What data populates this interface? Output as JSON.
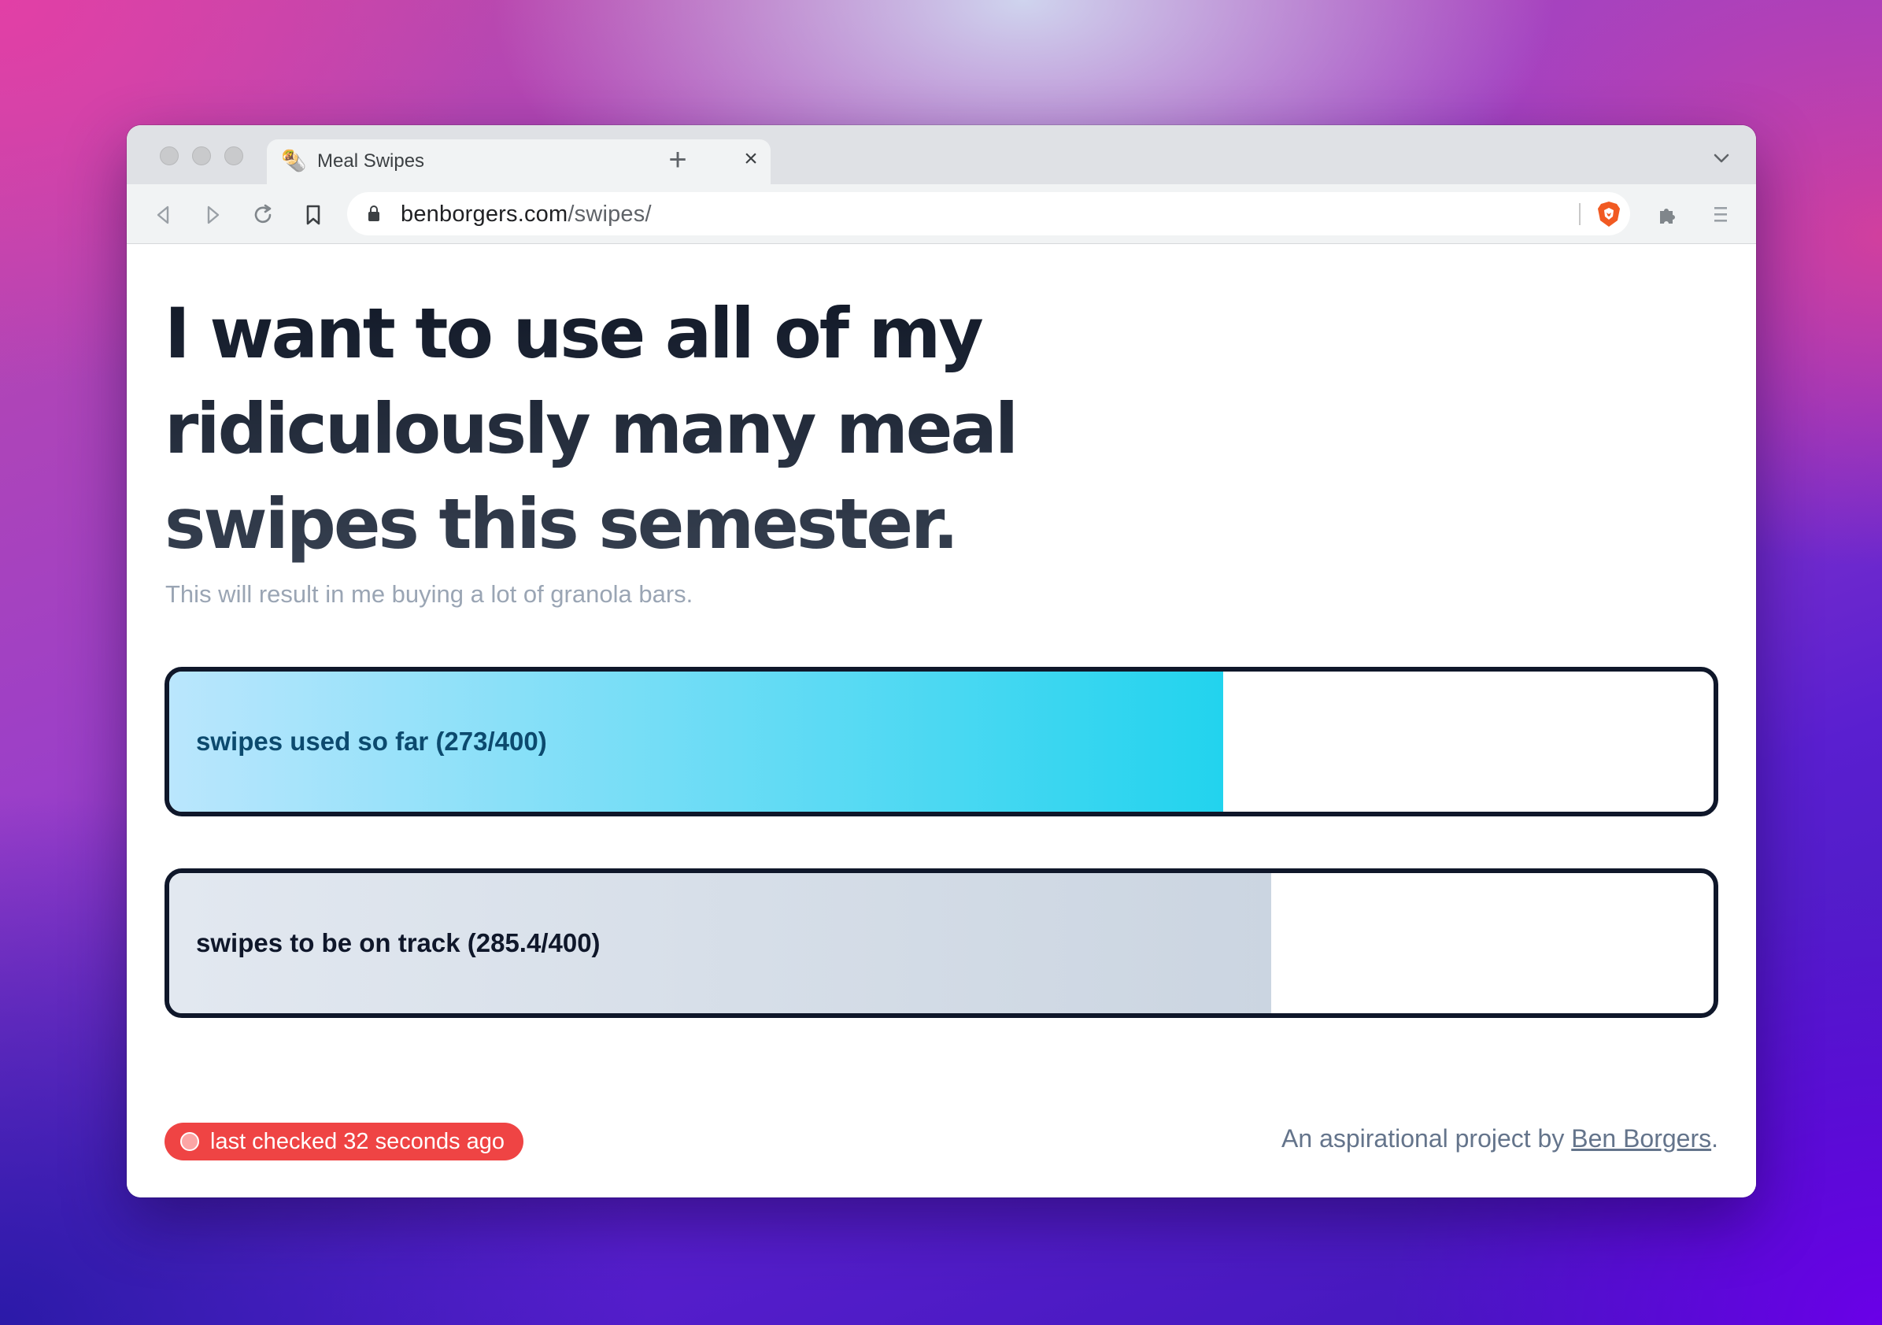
{
  "browser": {
    "tab": {
      "title": "Meal Swipes",
      "favicon": "burrito-emoji-icon"
    },
    "url": {
      "host": "benborgers.com",
      "path": "/swipes/"
    }
  },
  "page": {
    "headline": "I want to use all of my ridiculously many meal swipes this semester.",
    "subtitle": "This will result in me buying a lot of granola bars.",
    "bars": [
      {
        "label": "swipes used so far (273/400)",
        "value": 273,
        "max": 400,
        "fill_fraction": 0.6825,
        "gradient": [
          "#bae6fd",
          "#22d3ee"
        ]
      },
      {
        "label": "swipes to be on track (285.4/400)",
        "value": 285.4,
        "max": 400,
        "fill_fraction": 0.7135,
        "gradient": [
          "#e2e8f0",
          "#cbd5e1"
        ]
      }
    ],
    "status": {
      "text": "last checked 32 seconds ago",
      "color": "#ef4444"
    },
    "credit": {
      "prefix": "An aspirational project by ",
      "link": "Ben Borgers",
      "suffix": "."
    }
  }
}
